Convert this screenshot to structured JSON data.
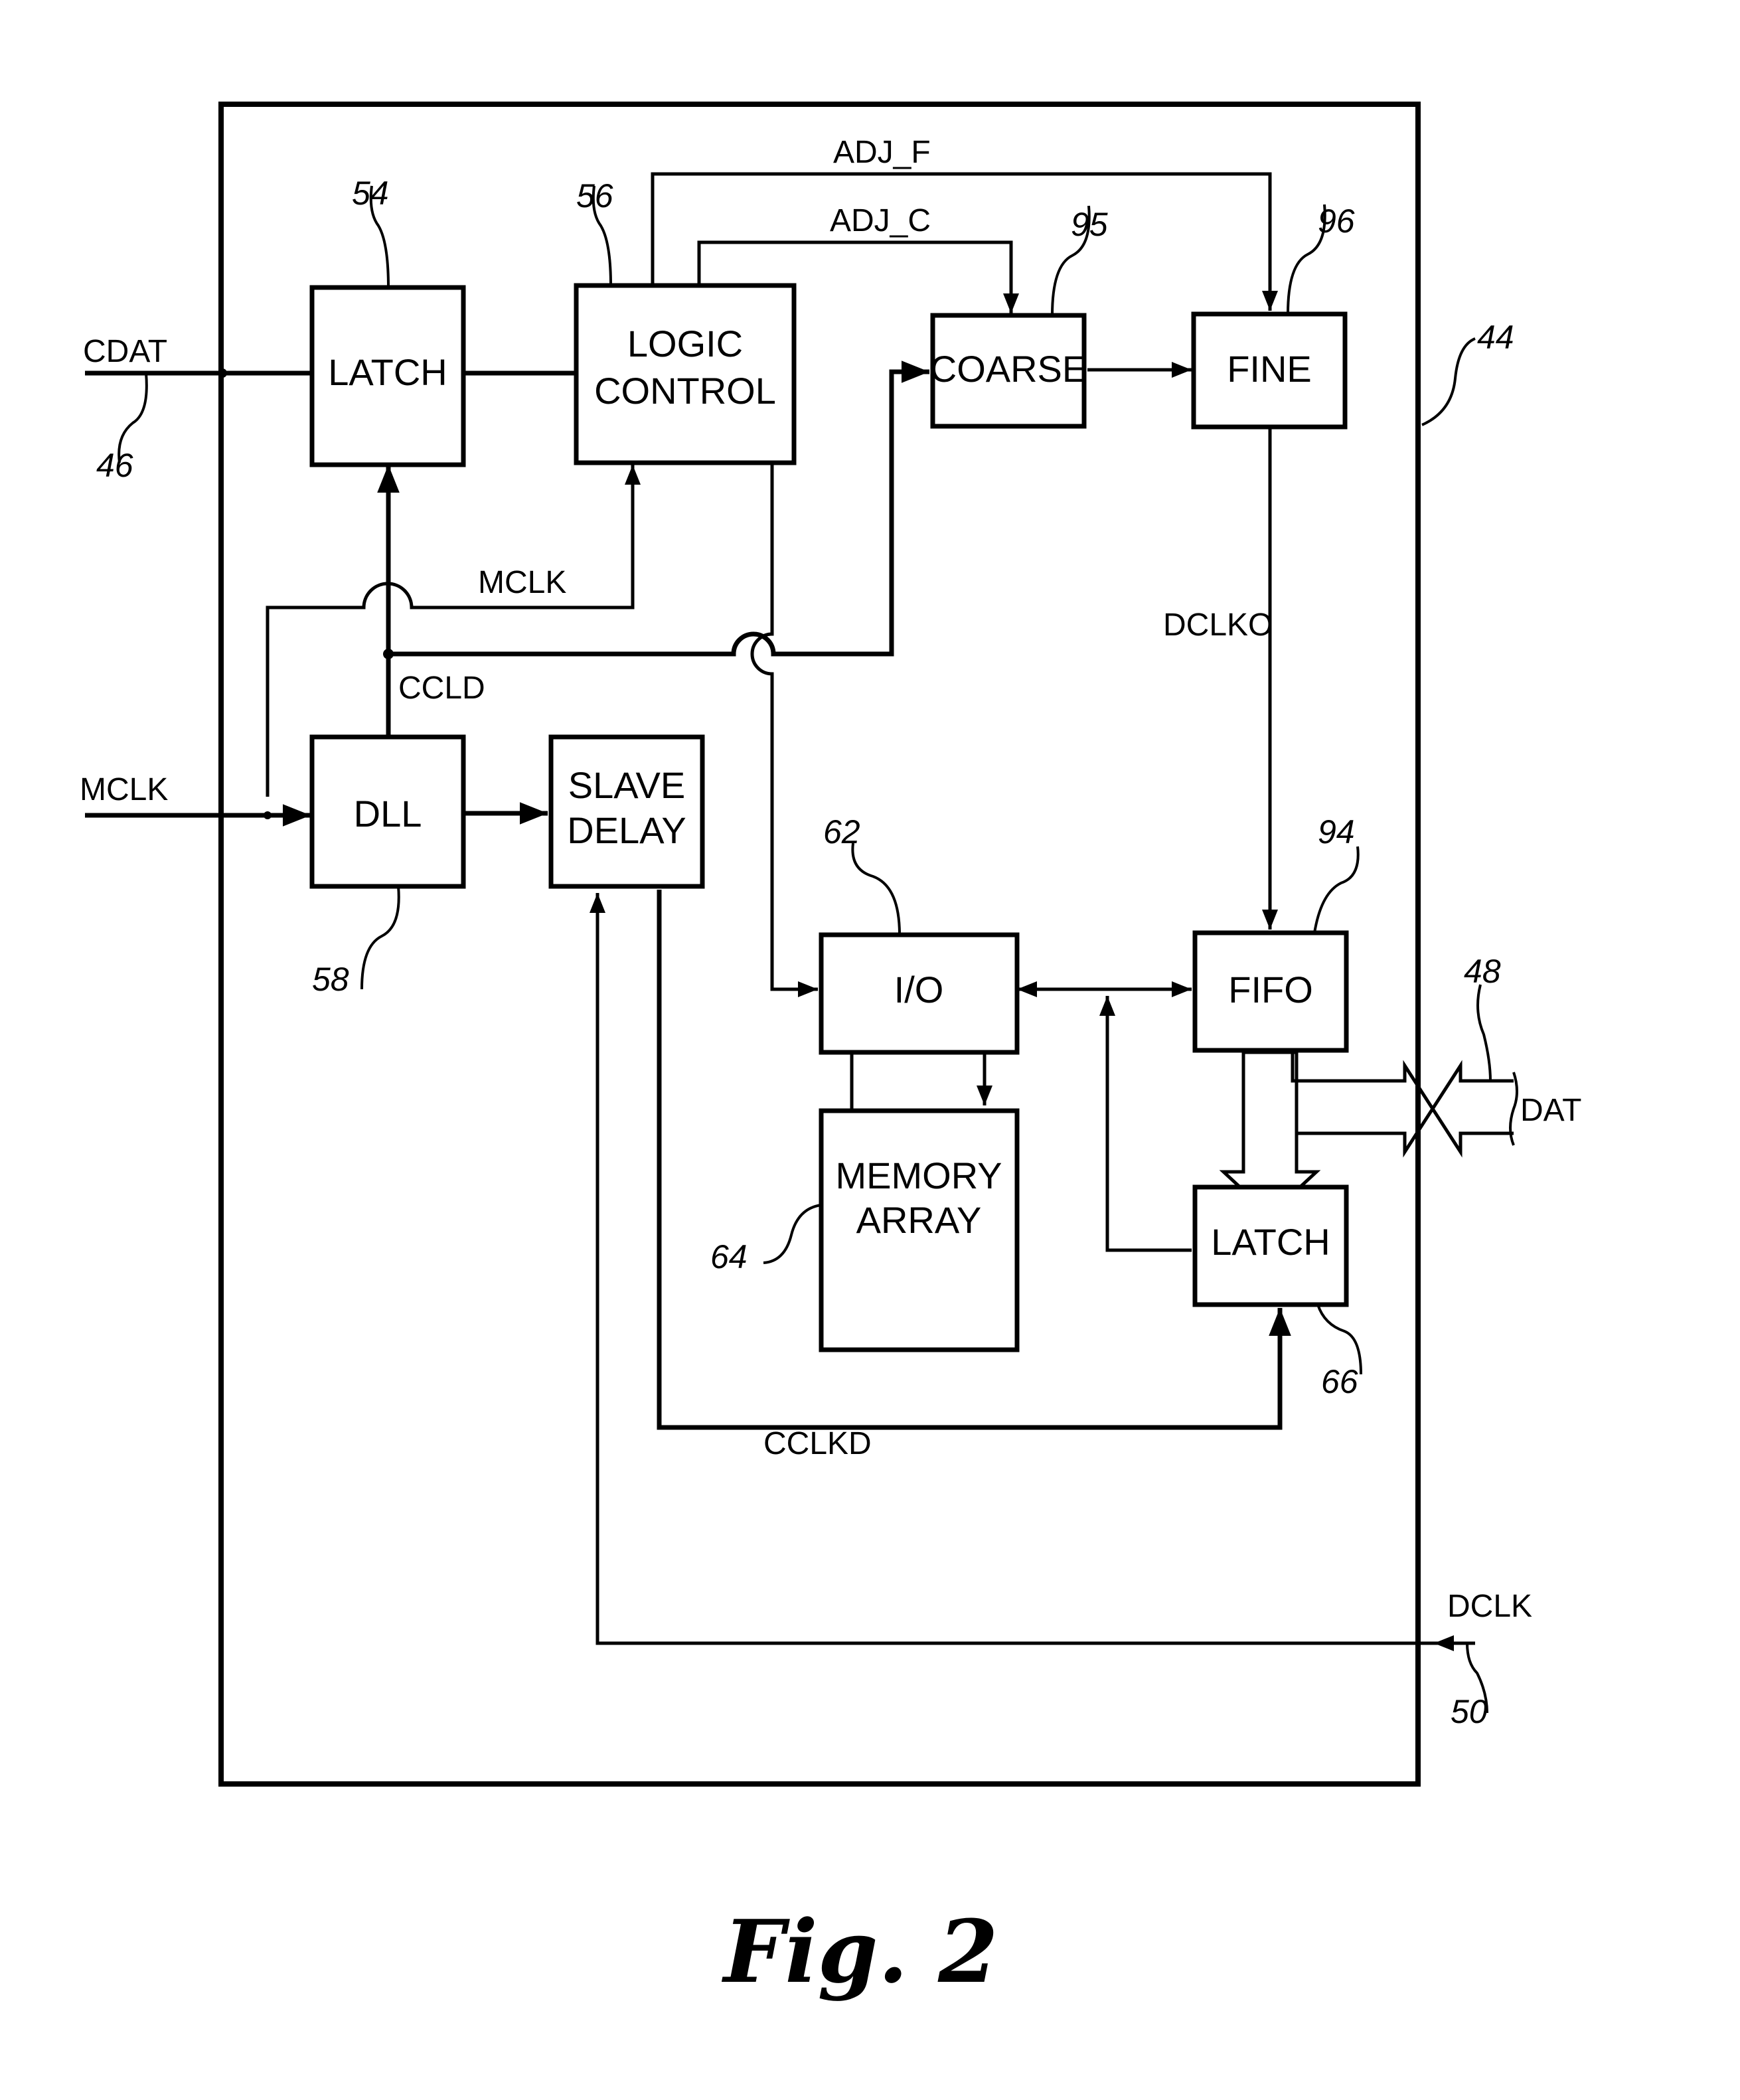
{
  "figure": {
    "caption": "Fig. 2",
    "chip_ref": "44"
  },
  "blocks": {
    "latch_in": {
      "label": [
        "LATCH"
      ],
      "ref": "54"
    },
    "logic_control": {
      "label": [
        "LOGIC",
        "CONTROL"
      ],
      "ref": "56"
    },
    "coarse": {
      "label": [
        "COARSE"
      ],
      "ref": "95"
    },
    "fine": {
      "label": [
        "FINE"
      ],
      "ref": "96"
    },
    "dll": {
      "label": [
        "DLL"
      ],
      "ref": "58"
    },
    "slave_delay": {
      "label": [
        "SLAVE",
        "DELAY"
      ],
      "ref": ""
    },
    "io": {
      "label": [
        "I/O"
      ],
      "ref": "62"
    },
    "fifo": {
      "label": [
        "FIFO"
      ],
      "ref": "94"
    },
    "memory_array": {
      "label": [
        "MEMORY",
        "ARRAY"
      ],
      "ref": "64"
    },
    "latch_out": {
      "label": [
        "LATCH"
      ],
      "ref": "66"
    }
  },
  "signals": {
    "cdat": {
      "label": "CDAT",
      "ref": "46"
    },
    "mclk_in": {
      "label": "MCLK"
    },
    "mclk_internal": {
      "label": "MCLK"
    },
    "ccld": {
      "label": "CCLD"
    },
    "adj_f": {
      "label": "ADJ_F"
    },
    "adj_c": {
      "label": "ADJ_C"
    },
    "dclko": {
      "label": "DCLKO"
    },
    "cclkd": {
      "label": "CCLKD"
    },
    "dat": {
      "label": "DAT",
      "ref": "48"
    },
    "dclk": {
      "label": "DCLK",
      "ref": "50"
    }
  }
}
